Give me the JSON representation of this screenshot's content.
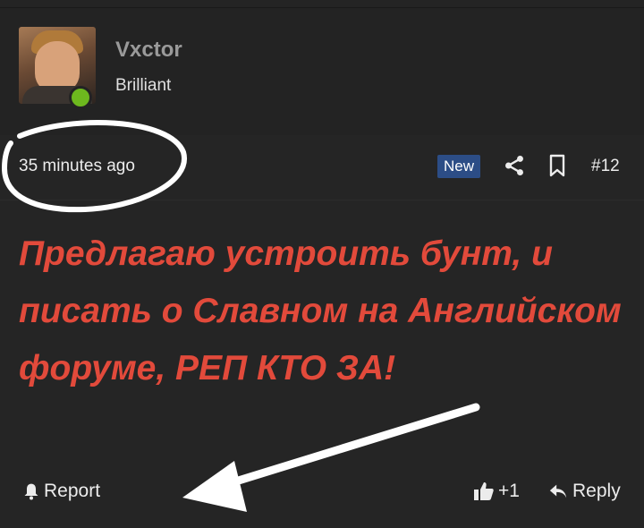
{
  "author": {
    "username": "Vxctor",
    "user_title": "Brilliant",
    "avatar_icon": "user-avatar",
    "online_status": "online",
    "online_color": "#6db81e"
  },
  "meta": {
    "timestamp": "35 minutes ago",
    "badge": "New",
    "badge_color": "#2c4d86",
    "share_icon": "share-icon",
    "bookmark_icon": "bookmark-icon",
    "post_number": "#12"
  },
  "message": {
    "text": "Предлагаю устроить бунт, и писать о Славном на Английском форуме, РЕП КТО ЗА!",
    "color": "#e24a3b"
  },
  "actions": {
    "report_label": "Report",
    "report_icon": "bell-icon",
    "like_label": "+1",
    "like_icon": "thumbs-up-icon",
    "reply_label": "Reply",
    "reply_icon": "reply-arrow-icon"
  },
  "colors": {
    "background": "#242424",
    "annotation": "#ffffff"
  }
}
